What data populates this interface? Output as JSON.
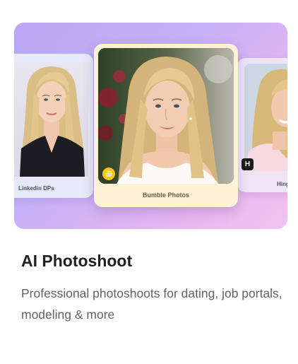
{
  "card": {
    "title": "AI Photoshoot",
    "description": "Professional photoshoots for dating, job portals, modeling & more"
  },
  "showcase": {
    "left_label": "Linkedin DPs",
    "center_label": "Bumble Photos",
    "right_label": "Hing",
    "left_icon": "portrait-photo",
    "center_badge_icon": "bumble-icon",
    "right_badge_icon": "hinge-icon",
    "right_badge_text": "H"
  },
  "colors": {
    "gradient_start": "#b9a7f4",
    "gradient_end": "#f4c2ef",
    "center_card_bg": "#fdf1d6",
    "bumble_yellow": "#f5c518",
    "hinge_black": "#1a1a1a",
    "title": "#1f1f24",
    "description": "#5f636d"
  }
}
